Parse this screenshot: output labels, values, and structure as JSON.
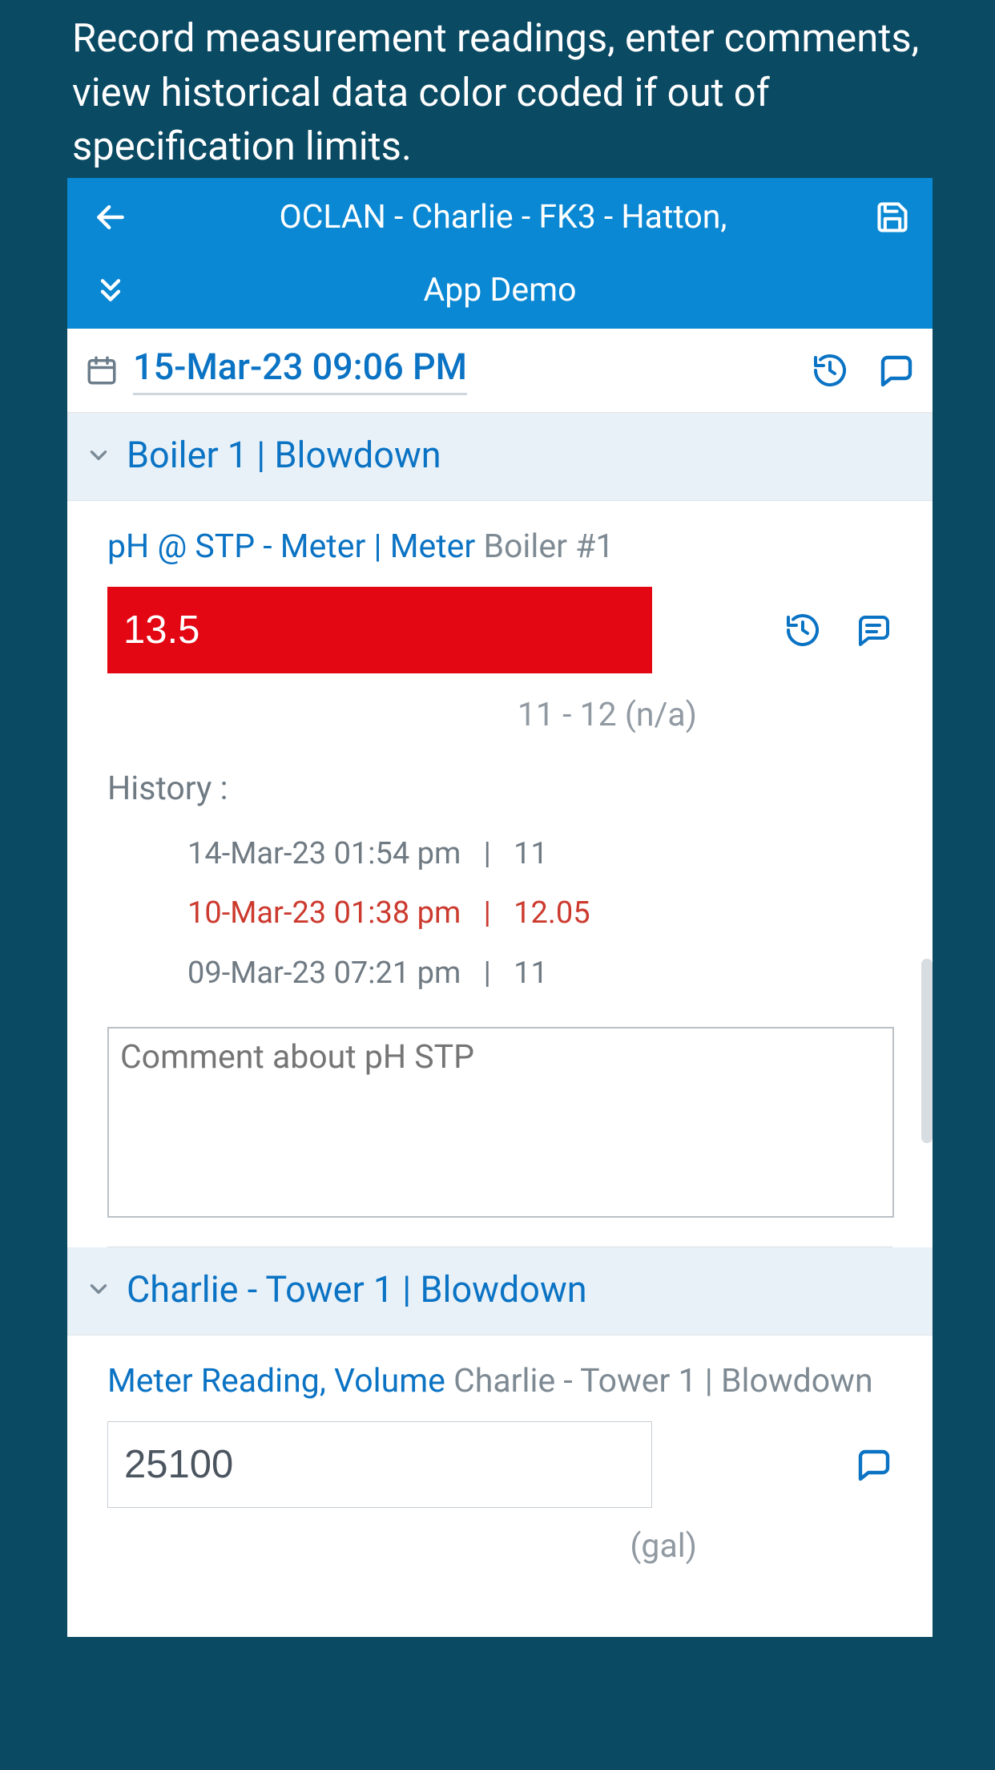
{
  "caption_text": "Record measurement readings, enter comments, view historical data color coded if out of specification limits.",
  "header": {
    "title": "OCLAN - Charlie - FK3 - Hatton,",
    "subtitle": "App Demo"
  },
  "date_bar": {
    "datetime": "15-Mar-23 09:06 PM"
  },
  "sections": [
    {
      "title": "Boiler 1 | Blowdown",
      "measurement": {
        "label_primary": "pH @ STP - Meter | Meter",
        "label_secondary": " Boiler #1",
        "value": "13.5",
        "out_of_spec": true,
        "spec_range": "11 - 12 (n/a)",
        "history_label": "History :",
        "history": [
          {
            "ts": "14-Mar-23 01:54 pm",
            "val": "11",
            "out_of_spec": false
          },
          {
            "ts": "10-Mar-23 01:38 pm",
            "val": "12.05",
            "out_of_spec": true
          },
          {
            "ts": "09-Mar-23 07:21 pm",
            "val": "11",
            "out_of_spec": false
          }
        ],
        "comment_placeholder": "Comment about pH STP"
      }
    },
    {
      "title": "Charlie - Tower 1 | Blowdown",
      "measurement": {
        "label_primary": "Meter Reading, Volume",
        "label_secondary": " Charlie - Tower 1 | Blowdown",
        "value": "25100",
        "out_of_spec": false,
        "unit": "(gal)"
      }
    }
  ],
  "colors": {
    "brand": "#0b88d3",
    "link": "#0b73c4",
    "alert_bg": "#e30613",
    "alert_text": "#cc3a2f",
    "bg_outer": "#0a4a63"
  }
}
